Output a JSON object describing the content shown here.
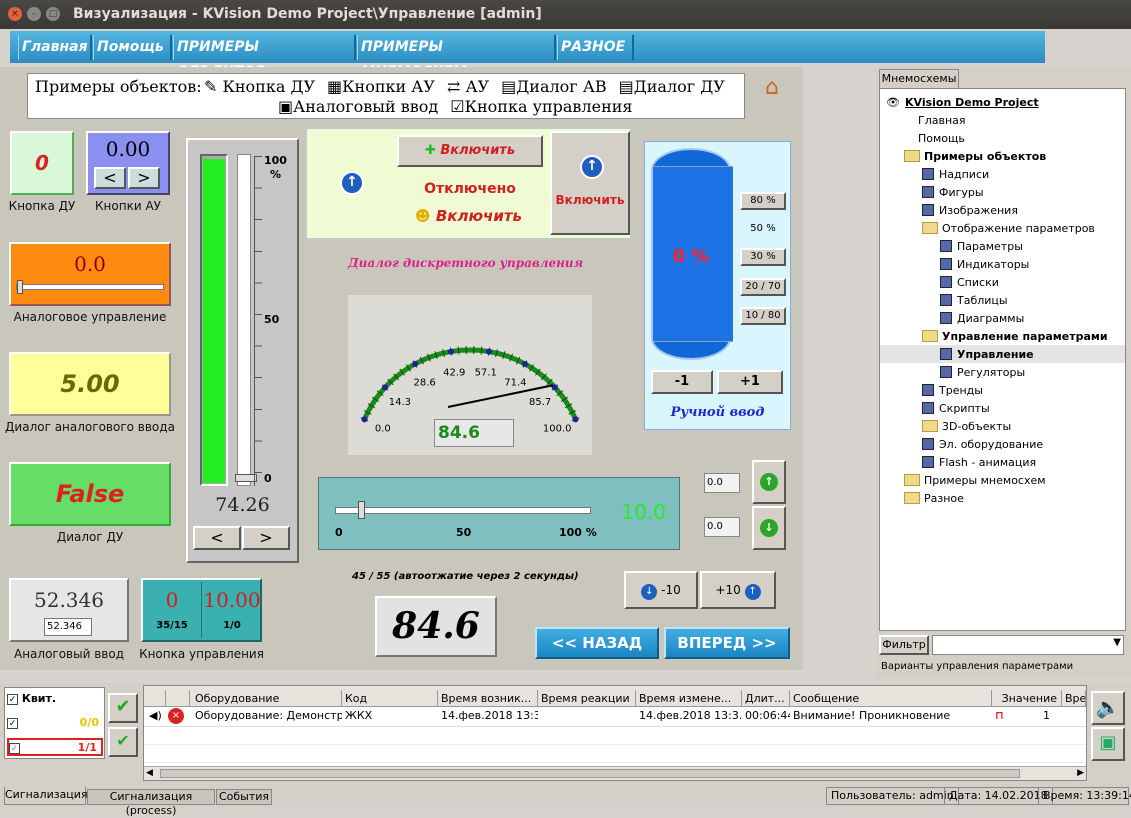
{
  "window": {
    "title": "Визуализация - KVision Demo Project\\Управление [admin]",
    "close_glyph": "×",
    "min_glyph": "–",
    "max_glyph": "□"
  },
  "menu": {
    "items": [
      "Главная",
      "Помощь",
      "ПРИМЕРЫ ОБЪЕКТОВ",
      "ПРИМЕРЫ МНЕМОСХЕМ",
      "РАЗНОЕ"
    ]
  },
  "examples": {
    "prefix": "Примеры объектов:",
    "links": [
      "Кнопка ДУ",
      "Кнопки АУ",
      "АУ",
      "Диалог АВ",
      "Диалог ДУ",
      "Аналоговый ввод",
      "Кнопка управления"
    ]
  },
  "knopka_du": {
    "value": "0",
    "label": "Кнопка ДУ"
  },
  "knopki_au": {
    "value": "0.00",
    "label": "Кнопки АУ",
    "left": "<",
    "right": ">"
  },
  "analog_control": {
    "value": "0.0",
    "label": "Аналоговое управление"
  },
  "analog_dialog": {
    "value": "5.00",
    "label": "Диалог аналогового ввода"
  },
  "dialog_du": {
    "value": "False",
    "label": "Диалог ДУ"
  },
  "analog_input": {
    "value": "52.346",
    "field": "52.346",
    "label": "Аналоговый ввод"
  },
  "control_button": {
    "left_value": "0",
    "right_value": "10.00",
    "left_sub": "35/15",
    "right_sub": "1/0",
    "label": "Кнопка управления"
  },
  "vertical_bar": {
    "ticks": [
      "100",
      "%",
      "50",
      "0"
    ],
    "value": "74.26",
    "fill": 1.0,
    "left": "<",
    "right": ">"
  },
  "discrete": {
    "btn_on": "Включить",
    "status": "Отключено",
    "smile_on": "Включить",
    "right_btn": "Включить",
    "caption": "Диалог дискретного управления"
  },
  "gauge": {
    "ticks": [
      "0.0",
      "14.3",
      "28.6",
      "42.9",
      "57.1",
      "71.4",
      "85.7",
      "100.0"
    ],
    "value": "84.6",
    "reading": 84.6
  },
  "tank": {
    "value": "0 %",
    "presets": [
      "80 %",
      "50 %",
      "30 %",
      "20 / 70",
      "10 / 80"
    ],
    "minus": "-1",
    "plus": "+1",
    "caption": "Ручной ввод"
  },
  "slider": {
    "ticks": [
      "0",
      "50",
      "100 %"
    ],
    "value": "10.0",
    "pos": 0.1
  },
  "steppers": {
    "top": "0.0",
    "bottom": "0.0",
    "minus": "-10",
    "plus": "+10"
  },
  "autopress": {
    "text": "45 / 55 (автоотжатие через 2 секунды)"
  },
  "big_value": "84.6",
  "nav": {
    "back": "<< НАЗАД",
    "forward": "ВПЕРЕД >>"
  },
  "tree": {
    "tab": "Мнемосхемы",
    "rows": [
      {
        "t": "KVision Demo Project",
        "lvl": 0,
        "icon": "eye",
        "bold": true,
        "ul": true
      },
      {
        "t": "Главная",
        "lvl": 1,
        "icon": "none"
      },
      {
        "t": "Помощь",
        "lvl": 1,
        "icon": "none"
      },
      {
        "t": "Примеры объектов",
        "lvl": 1,
        "icon": "folder",
        "bold": true
      },
      {
        "t": "Надписи",
        "lvl": 2,
        "icon": "page"
      },
      {
        "t": "Фигуры",
        "lvl": 2,
        "icon": "page"
      },
      {
        "t": "Изображения",
        "lvl": 2,
        "icon": "page"
      },
      {
        "t": "Отображение параметров",
        "lvl": 2,
        "icon": "folder"
      },
      {
        "t": "Параметры",
        "lvl": 3,
        "icon": "page"
      },
      {
        "t": "Индикаторы",
        "lvl": 3,
        "icon": "page"
      },
      {
        "t": "Списки",
        "lvl": 3,
        "icon": "page"
      },
      {
        "t": "Таблицы",
        "lvl": 3,
        "icon": "page"
      },
      {
        "t": "Диаграммы",
        "lvl": 3,
        "icon": "page"
      },
      {
        "t": "Управление параметрами",
        "lvl": 2,
        "icon": "folder",
        "bold": true
      },
      {
        "t": "Управление",
        "lvl": 3,
        "icon": "page",
        "bold": true,
        "sel": true
      },
      {
        "t": "Регуляторы",
        "lvl": 3,
        "icon": "page"
      },
      {
        "t": "Тренды",
        "lvl": 2,
        "icon": "page"
      },
      {
        "t": "Скрипты",
        "lvl": 2,
        "icon": "page"
      },
      {
        "t": "3D-объекты",
        "lvl": 2,
        "icon": "folder"
      },
      {
        "t": "Эл. оборудование",
        "lvl": 2,
        "icon": "page"
      },
      {
        "t": "Flash - анимация",
        "lvl": 2,
        "icon": "page"
      },
      {
        "t": "Примеры мнемосхем",
        "lvl": 1,
        "icon": "folder"
      },
      {
        "t": "Разное",
        "lvl": 1,
        "icon": "folder"
      }
    ],
    "filter_label": "Фильтр",
    "footer": "Варианты управления параметрами"
  },
  "alarms": {
    "kvit": "Квит.",
    "count1": "0/0",
    "count2": "1/1",
    "headers": [
      "Оборудование",
      "Код",
      "Время возник...",
      "Время реакции",
      "Время измене...",
      "Длит...",
      "Сообщение",
      "Значение",
      "Вре"
    ],
    "row": {
      "equip": "Оборудование: Демонстр...",
      "code": "ЖКХ",
      "t_start": "14.фев.2018 13:3...",
      "t_react": "",
      "t_change": "14.фев.2018 13:3...",
      "dur": "00:06:44",
      "msg": "Внимание! Проникновение",
      "val": "1"
    }
  },
  "tabs": [
    "Сигнализация",
    "Сигнализация (process)",
    "События"
  ],
  "status": {
    "user": "Пользователь: admin",
    "date": "Дата: 14.02.2018",
    "time": "Время: 13:39:14"
  }
}
